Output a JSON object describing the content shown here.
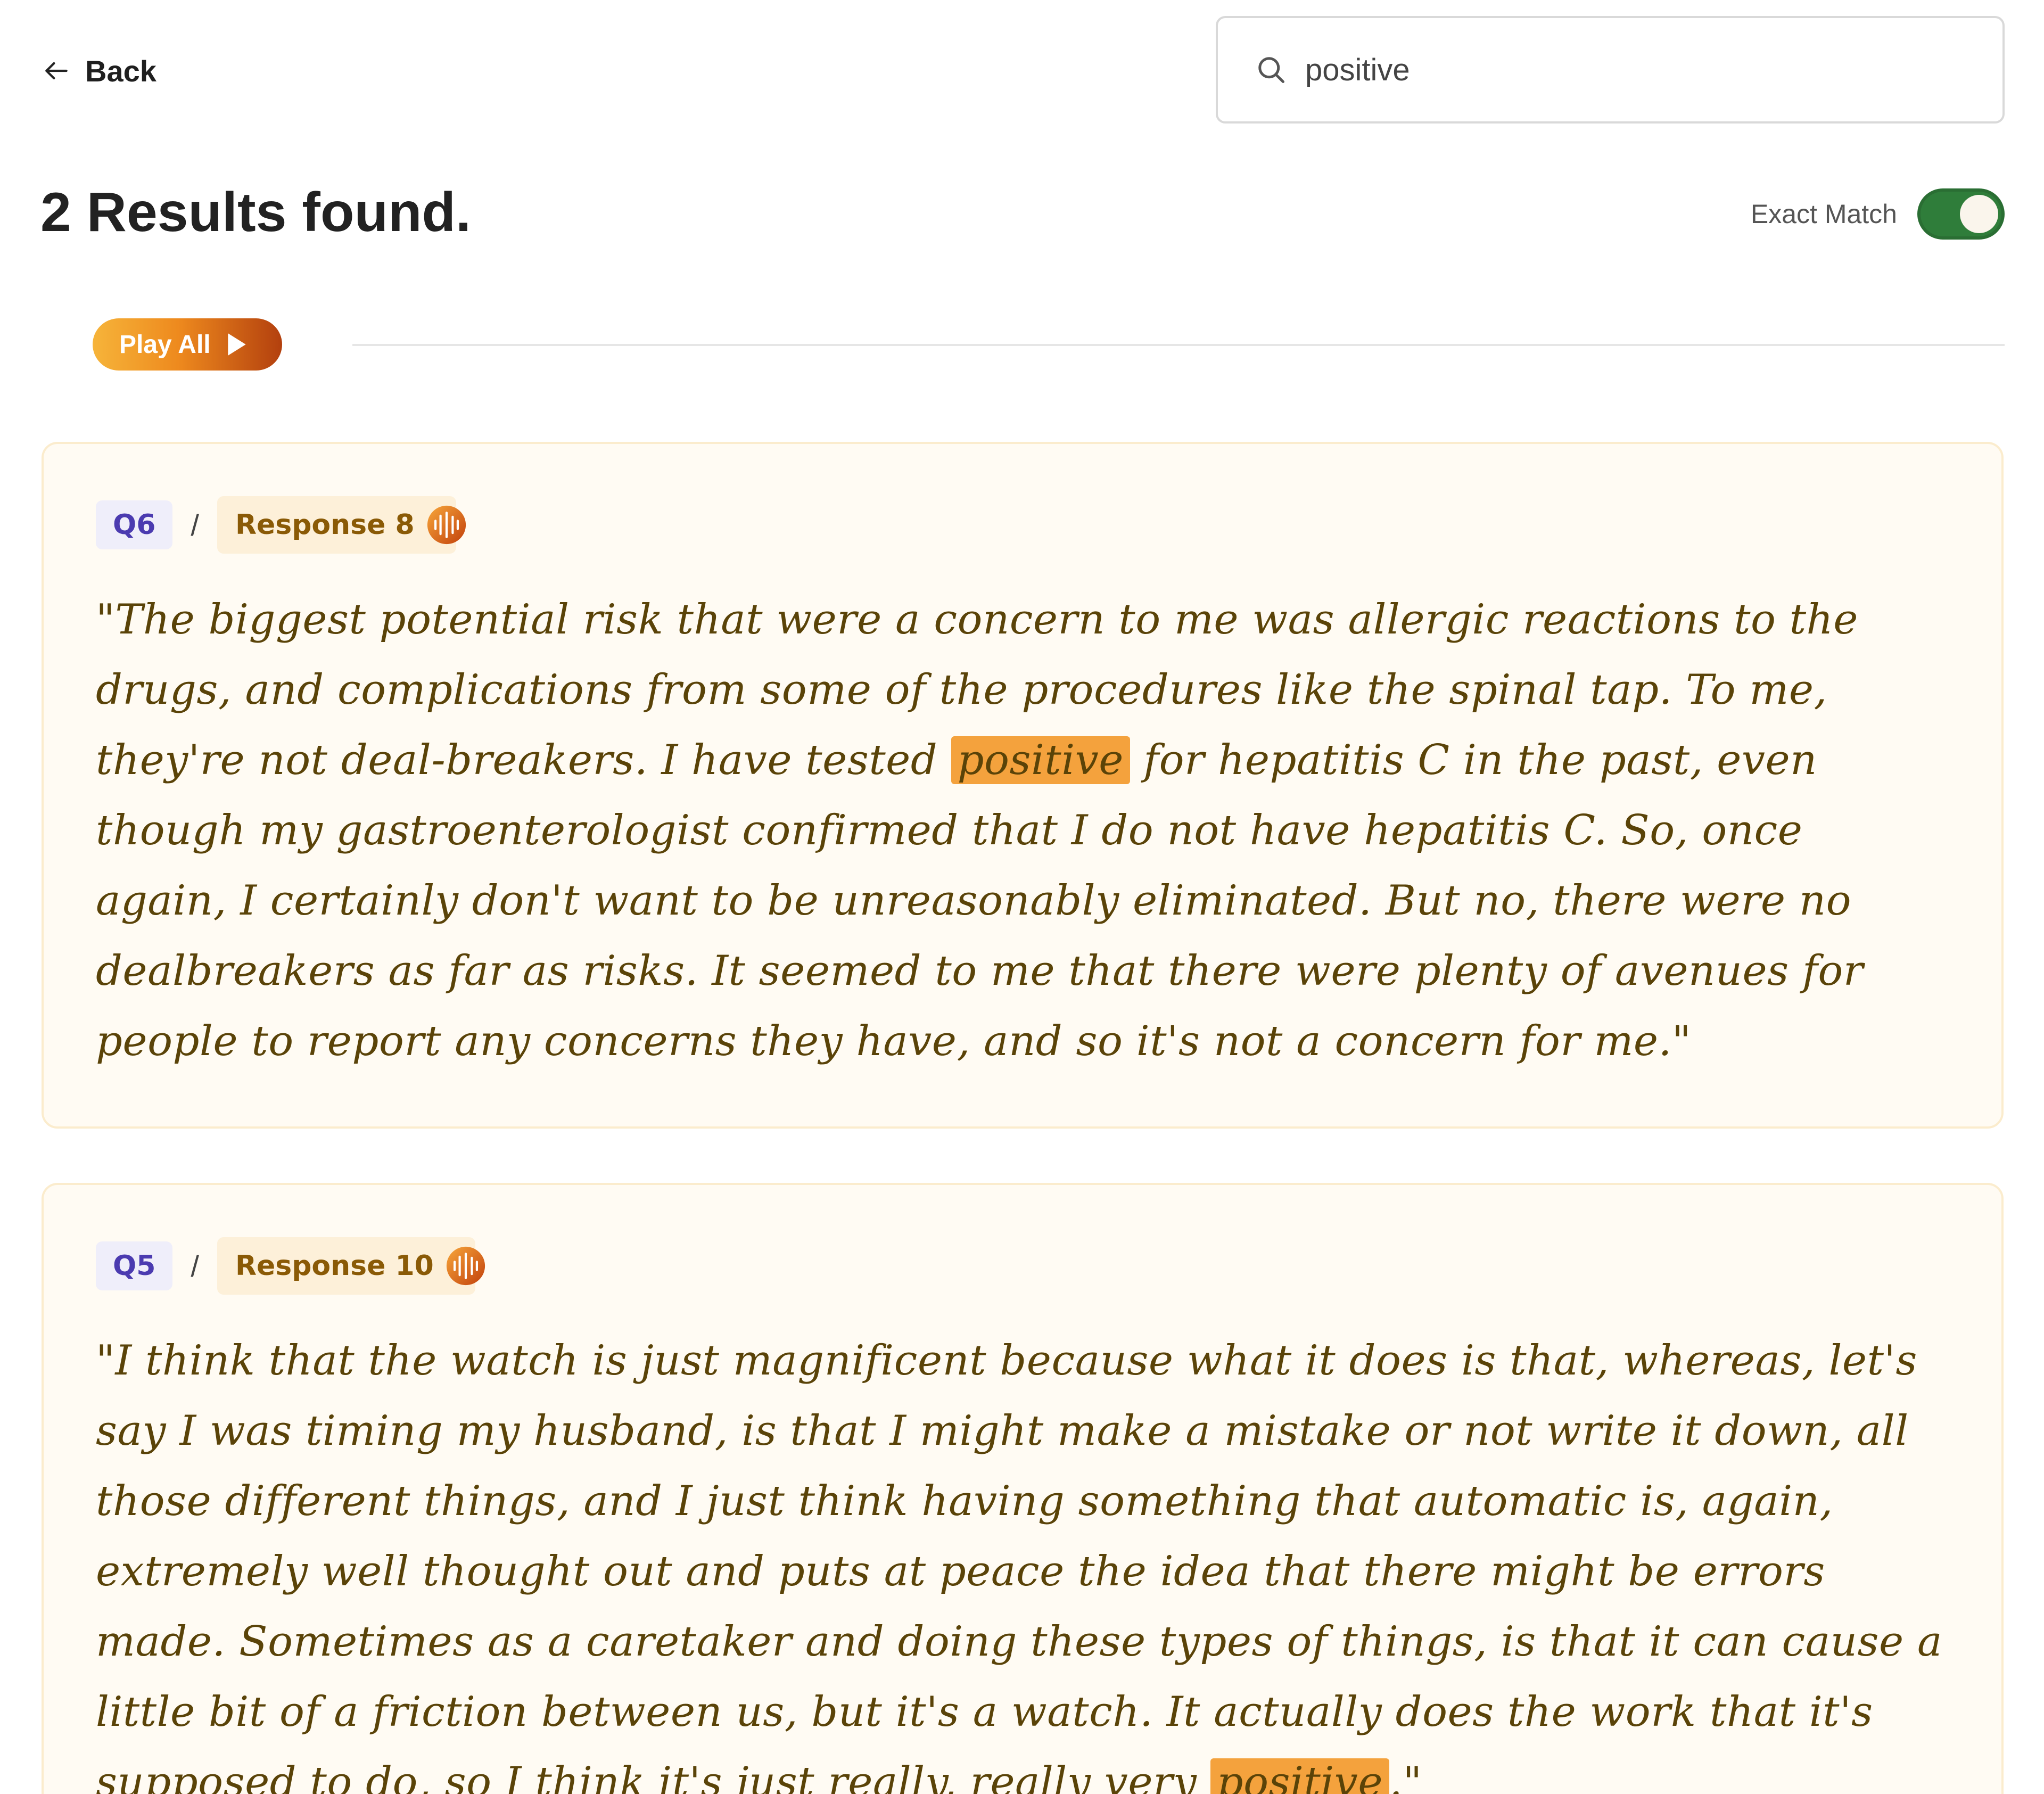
{
  "header": {
    "back_label": "Back"
  },
  "search": {
    "value": "positive",
    "placeholder": ""
  },
  "results": {
    "title": "2 Results found.",
    "exact_match_label": "Exact Match",
    "exact_match_on": true,
    "play_all_label": "Play All"
  },
  "cards": [
    {
      "question": "Q6",
      "separator": "/",
      "response": "Response 8",
      "quote_before": "\"The biggest potential risk that were a concern to me was allergic reactions to the drugs, and complications from some of the procedures like the spinal tap. To me, they're not deal-breakers. I have tested ",
      "highlight": "positive",
      "quote_after": " for hepatitis C in the past, even though my gastroenterologist confirmed that I do not have hepatitis C. So, once again, I certainly don't want to be unreasonably eliminated. But no, there were no dealbreakers as far as risks. It seemed to me that there were plenty of avenues for people to report any concerns they have, and so it's not a concern for me.\""
    },
    {
      "question": "Q5",
      "separator": "/",
      "response": "Response 10",
      "quote_before": "\"I think that the watch is just magnificent because what it does is that, whereas, let's say I was timing my husband, is that I might make a mistake or not write it down, all those different things, and I just think having something that automatic is, again, extremely well thought out and puts at peace the idea that there might be errors made. Sometimes as a caretaker and doing these types of things, is that it can cause a little bit of a friction between us, but it's a watch. It actually does the work that it's supposed to do, so I think it's just really, really very ",
      "highlight": "positive",
      "quote_after": ".\""
    }
  ],
  "colors": {
    "toggle_on": "#2f7d3a",
    "highlight": "#f4a23d",
    "quote_text": "#5a4308",
    "question_tag": "#4b3bb0",
    "response_tag": "#8a5a06",
    "card_bg": "#fffbf3"
  },
  "icons": {
    "back": "arrow-left-icon",
    "search": "search-icon",
    "play": "play-icon",
    "audio": "audio-waveform-icon"
  }
}
